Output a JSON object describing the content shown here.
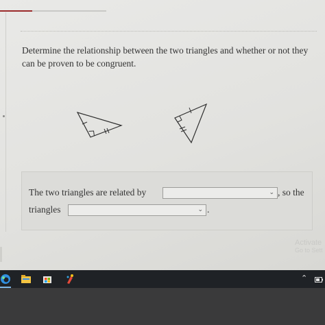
{
  "question": {
    "text": "Determine the relationship between the two triangles and whether or not they can be proven to be congruent."
  },
  "answer": {
    "prefix": "The two triangles are related by",
    "middle": ", so the",
    "line2_label": "triangles",
    "suffix": ".",
    "dropdown1_value": "",
    "dropdown2_value": ""
  },
  "progress": {
    "fraction": 0.3
  },
  "watermark": {
    "line1": "Activate",
    "line2": "Go to Sett"
  },
  "colors": {
    "accent": "#9a2a2a",
    "taskbar": "#1f2226",
    "panel": "#dcdcd9"
  },
  "taskbar": {
    "icons": [
      "edge-icon",
      "file-explorer-icon",
      "store-icon",
      "paint-icon"
    ],
    "tray_icons": [
      "chevron-up-icon",
      "battery-icon"
    ]
  }
}
